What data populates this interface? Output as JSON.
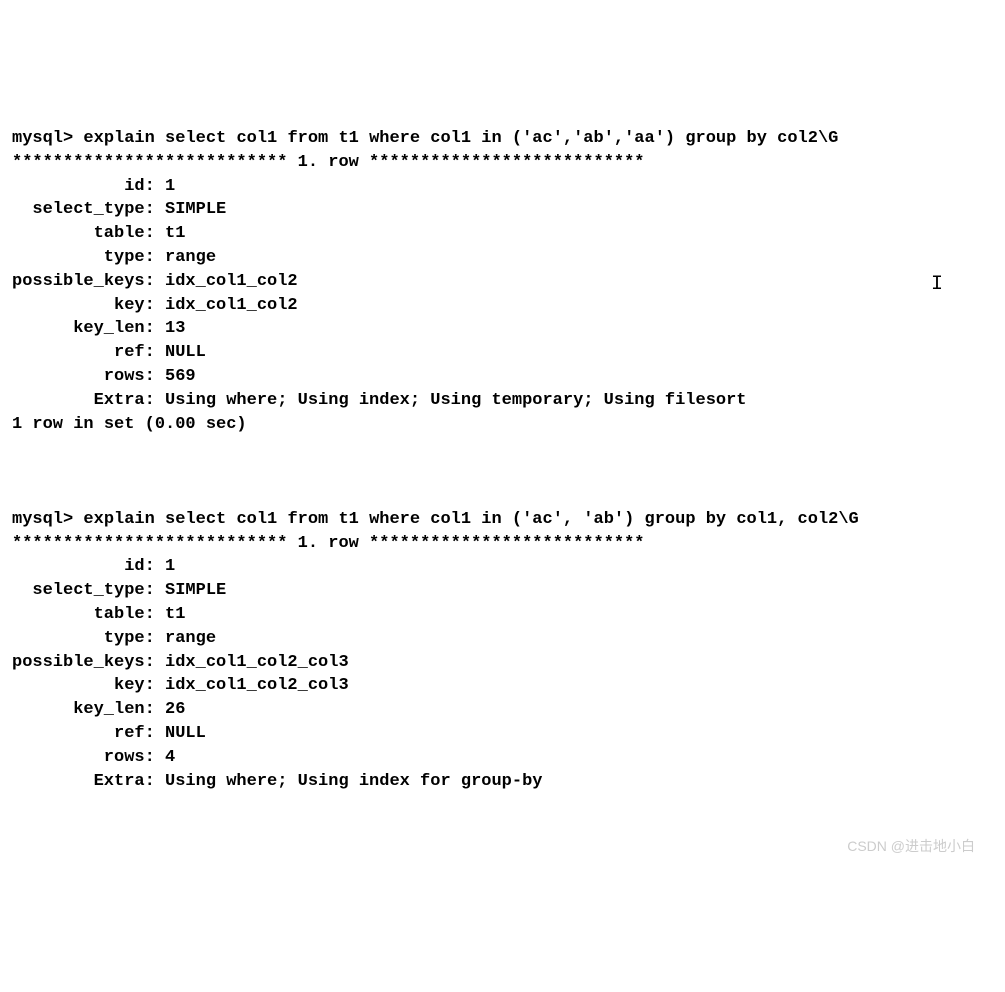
{
  "query1": {
    "prompt": "mysql>",
    "command": "explain select col1 from t1 where col1 in ('ac','ab','aa') group by col2\\G",
    "row_header": "*************************** 1. row ***************************",
    "fields": {
      "id": "1",
      "select_type": "SIMPLE",
      "table": "t1",
      "type": "range",
      "possible_keys": "idx_col1_col2",
      "key": "idx_col1_col2",
      "key_len": "13",
      "ref": "NULL",
      "rows": "569",
      "Extra": "Using where; Using index; Using temporary; Using filesort"
    },
    "footer": "1 row in set (0.00 sec)"
  },
  "query2": {
    "prompt": "mysql>",
    "command": "explain select col1 from t1 where col1 in ('ac', 'ab') group by col1, col2\\G",
    "row_header": "*************************** 1. row ***************************",
    "fields": {
      "id": "1",
      "select_type": "SIMPLE",
      "table": "t1",
      "type": "range",
      "possible_keys": "idx_col1_col2_col3",
      "key": "idx_col1_col2_col3",
      "key_len": "26",
      "ref": "NULL",
      "rows": "4",
      "Extra": "Using where; Using index for group-by"
    }
  },
  "labels": {
    "id": "id",
    "select_type": "select_type",
    "table": "table",
    "type": "type",
    "possible_keys": "possible_keys",
    "key": "key",
    "key_len": "key_len",
    "ref": "ref",
    "rows": "rows",
    "Extra": "Extra"
  },
  "watermark": "CSDN @进击地小白",
  "cursor_glyph": "I"
}
